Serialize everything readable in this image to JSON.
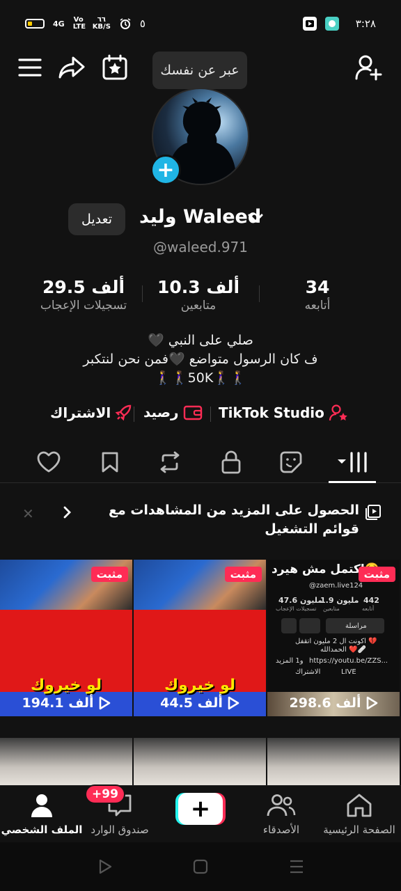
{
  "status_bar": {
    "left_net": "4G",
    "volte": "Vo LTE",
    "speed_value": "٦٦",
    "speed_unit": "KB/S",
    "alarm_icon": "alarm-icon",
    "notify_digit": "٥",
    "time": "٣:٢٨"
  },
  "top_nav": {
    "tooltip": "عبر عن نفسك",
    "icons": [
      "menu-icon",
      "share-icon",
      "calendar-star-icon",
      "add-friend-icon"
    ]
  },
  "profile": {
    "display_name": "وليد Waleed",
    "username": "@waleed.971",
    "edit_label": "تعديل"
  },
  "stats": {
    "following": {
      "value": "34",
      "label": "أتابعه"
    },
    "followers": {
      "value": "10.3 ألف",
      "label": "متابعين"
    },
    "likes": {
      "value": "29.5 ألف",
      "label": "تسجيلات الإعجاب"
    }
  },
  "bio": {
    "line1": "صلي على النبي 🖤",
    "line2": "ف كان الرسول متواضع 🖤فمن نحن لنتكبر",
    "line3": "🚶‍♀️🚶‍♀️50K🚶‍♀️🚶‍♀️"
  },
  "links": {
    "studio": "TikTok Studio",
    "balance": "رصيد",
    "subscribe": "الاشتراك"
  },
  "banner": {
    "text": "الحصول على المزيد من المشاهدات مع قوائم التشغيل"
  },
  "grid": {
    "pinned_label": "مثبت",
    "videos": [
      {
        "caption": "لو خيروك",
        "views": "194.1 ألف"
      },
      {
        "caption": "لو خيروك",
        "views": "44.5 ألف"
      },
      {
        "title": "اكتمل مش هيرد🥺",
        "handle": "@zaem.live124",
        "views": "298.6 ألف",
        "stat_a": "442",
        "stat_a_label": "أتابعه",
        "stat_b": "1.9 مليون",
        "stat_b_label": "متابعين",
        "stat_c": "47.6 مليون",
        "stat_c_label": "تسجيلات الإعجاب",
        "msg": "مراسلة",
        "bio1": "اكونت ال 2 مليون اتقفل 💔",
        "bio2": "الحمدالله ❤️🩹",
        "link": "https://youtu.be/ZZS...",
        "link2": "و1 المزيد",
        "live": "LIVE",
        "sub": "الاشتراك"
      }
    ]
  },
  "bottom_nav": {
    "home": "الصفحة الرئيسية",
    "friends": "الأصدقاء",
    "inbox": "صندوق الوارد",
    "inbox_badge": "+99",
    "profile": "الملف الشخصي"
  }
}
